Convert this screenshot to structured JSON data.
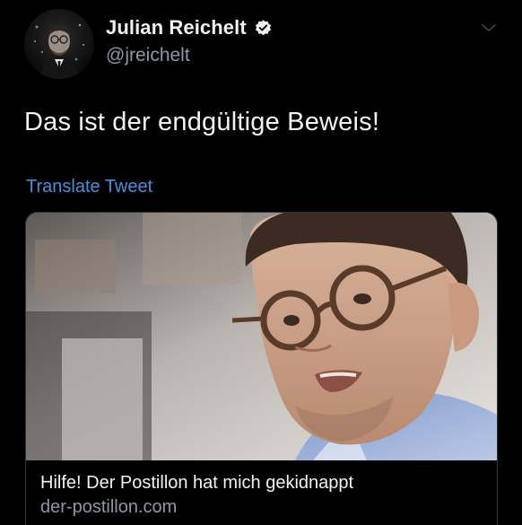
{
  "author": {
    "display_name": "Julian Reichelt",
    "handle": "@jreichelt"
  },
  "tweet": {
    "text": "Das ist der endgültige Beweis!",
    "translate_label": "Translate Tweet"
  },
  "link_card": {
    "title": "Hilfe! Der Postillon hat mich gekidnappt",
    "domain": "der-postillon.com"
  },
  "colors": {
    "background": "#000000",
    "link": "#4a90d9",
    "secondary_text": "#8b98a5"
  },
  "icons": {
    "verified": "verified-badge-icon",
    "caret": "chevron-down-icon"
  }
}
